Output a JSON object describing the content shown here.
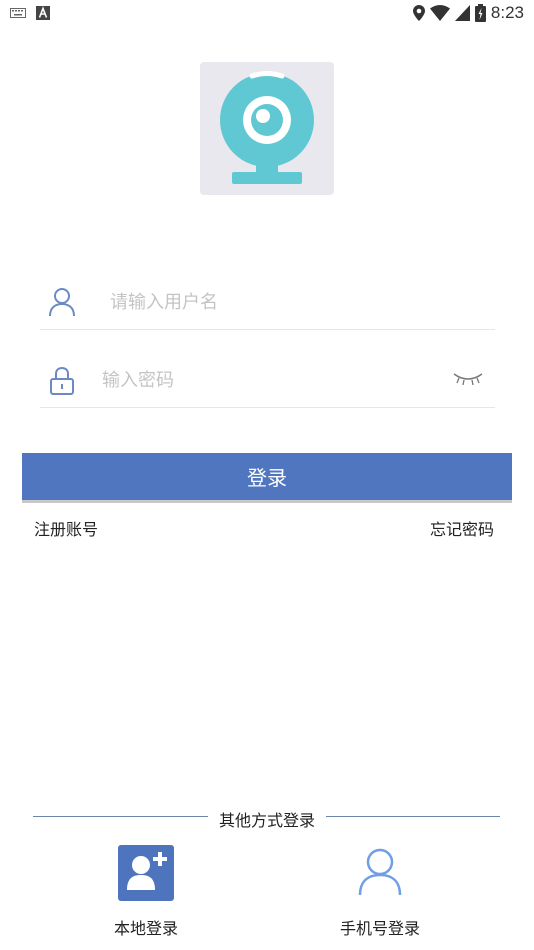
{
  "status_bar": {
    "time": "8:23",
    "left_icons": [
      "keyboard-icon",
      "font-a-icon"
    ],
    "right_icons": [
      "location-icon",
      "wifi-icon",
      "signal-icon",
      "battery-icon"
    ]
  },
  "logo": {
    "icon": "webcam-icon",
    "colors": {
      "tile": "#e9e8ee",
      "camera": "#5fc8d2"
    }
  },
  "username": {
    "placeholder": "请输入用户名",
    "value": "",
    "icon": "user-icon"
  },
  "password": {
    "placeholder": "输入密码",
    "value": "",
    "icon": "lock-icon",
    "toggle_icon": "eye-closed-icon"
  },
  "login_button": {
    "label": "登录",
    "color": "#5176c0"
  },
  "links": {
    "register": "注册账号",
    "forgot": "忘记密码"
  },
  "other_login": {
    "title": "其他方式登录",
    "options": [
      {
        "label": "本地登录",
        "icon": "add-user-icon"
      },
      {
        "label": "手机号登录",
        "icon": "user-outline-icon"
      }
    ]
  }
}
